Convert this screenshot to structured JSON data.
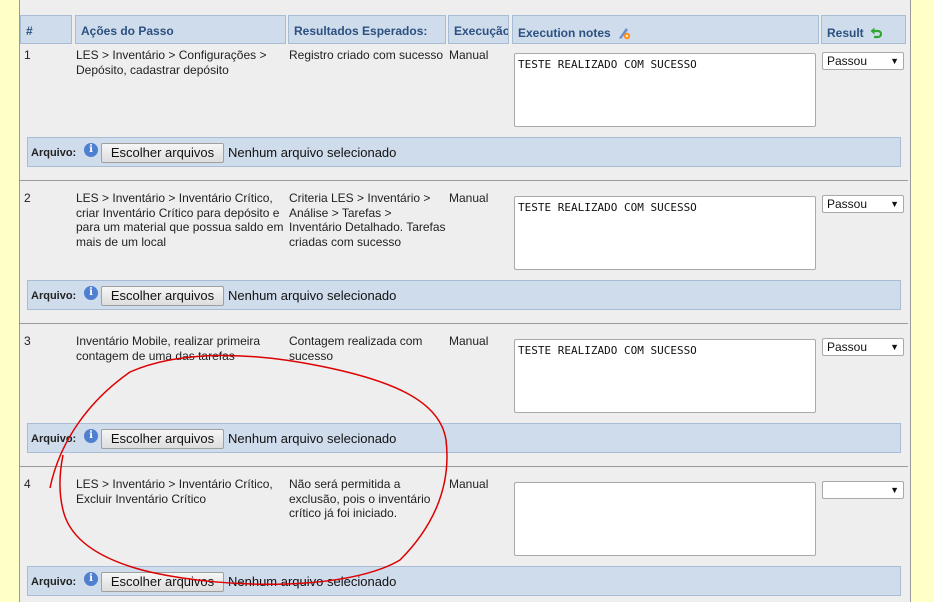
{
  "header": {
    "col_num": "#",
    "col_actions": "Ações do Passo",
    "col_expected": "Resultados Esperados:",
    "col_execution": "Execução",
    "col_notes": "Execution notes",
    "col_result": "Result"
  },
  "steps": [
    {
      "num": "1",
      "actions": "LES > Inventário > Configurações > Depósito, cadastrar depósito",
      "expected": "Registro criado com sucesso",
      "execution": "Manual",
      "notes": "TESTE REALIZADO COM SUCESSO",
      "result": "Passou"
    },
    {
      "num": "2",
      "actions": "LES > Inventário > Inventário Crítico, criar Inventário Crítico para depósito e para um material que possua saldo em mais de um local",
      "expected": "Criteria LES > Inventário > Análise > Tarefas > Inventário Detalhado. Tarefas criadas com sucesso",
      "execution": "Manual",
      "notes": "TESTE REALIZADO COM SUCESSO",
      "result": "Passou"
    },
    {
      "num": "3",
      "actions": "Inventário Mobile, realizar primeira contagem de uma das tarefas",
      "expected": "Contagem realizada com sucesso",
      "execution": "Manual",
      "notes": "TESTE REALIZADO COM SUCESSO",
      "result": "Passou"
    },
    {
      "num": "4",
      "actions": "LES > Inventário > Inventário Crítico, Excluir Inventário Crítico",
      "expected": "Não será permitida a exclusão, pois o inventário crítico já foi iniciado.",
      "execution": "Manual",
      "notes": "",
      "result": ""
    }
  ],
  "attachment": {
    "label": "Arquivo:",
    "button": "Escolher arquivos",
    "status": "Nenhum arquivo selecionado"
  },
  "icons": {
    "notes": "bulk-edit-icon",
    "result": "green-return-arrow-icon",
    "info": "info-icon"
  },
  "colors": {
    "page_bg": "#ffffc8",
    "table_bg": "#eeeeee",
    "header_bg": "#cfdcec",
    "header_text": "#2c5080",
    "annotation": "#dd0000"
  }
}
